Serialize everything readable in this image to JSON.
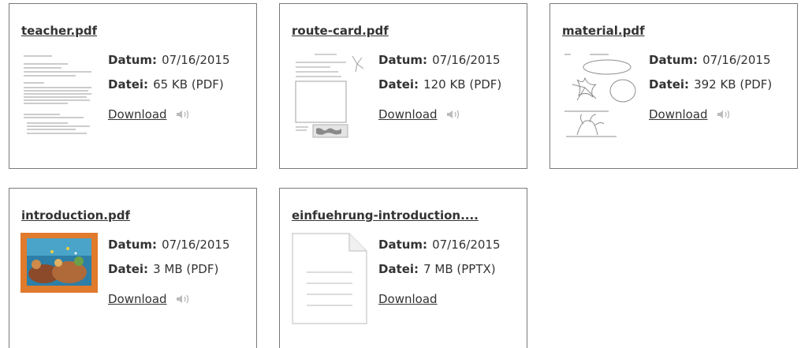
{
  "labels": {
    "date": "Datum:",
    "file": "Datei:",
    "download": "Download"
  },
  "cards": [
    {
      "title": "teacher.pdf",
      "date": "07/16/2015",
      "file": "65 KB (PDF)",
      "thumb": "text-document",
      "audio": true
    },
    {
      "title": "route-card.pdf",
      "date": "07/16/2015",
      "file": "120 KB (PDF)",
      "thumb": "worksheet-map",
      "audio": true
    },
    {
      "title": "material.pdf",
      "date": "07/16/2015",
      "file": "392 KB (PDF)",
      "thumb": "worksheet-illustration",
      "audio": true
    },
    {
      "title": "introduction.pdf",
      "date": "07/16/2015",
      "file": "3 MB (PDF)",
      "thumb": "coral-reef-photo",
      "audio": true
    },
    {
      "title": "einfuehrung-introduction....",
      "date": "07/16/2015",
      "file": "7 MB (PPTX)",
      "thumb": "generic-file-icon",
      "audio": false
    }
  ]
}
